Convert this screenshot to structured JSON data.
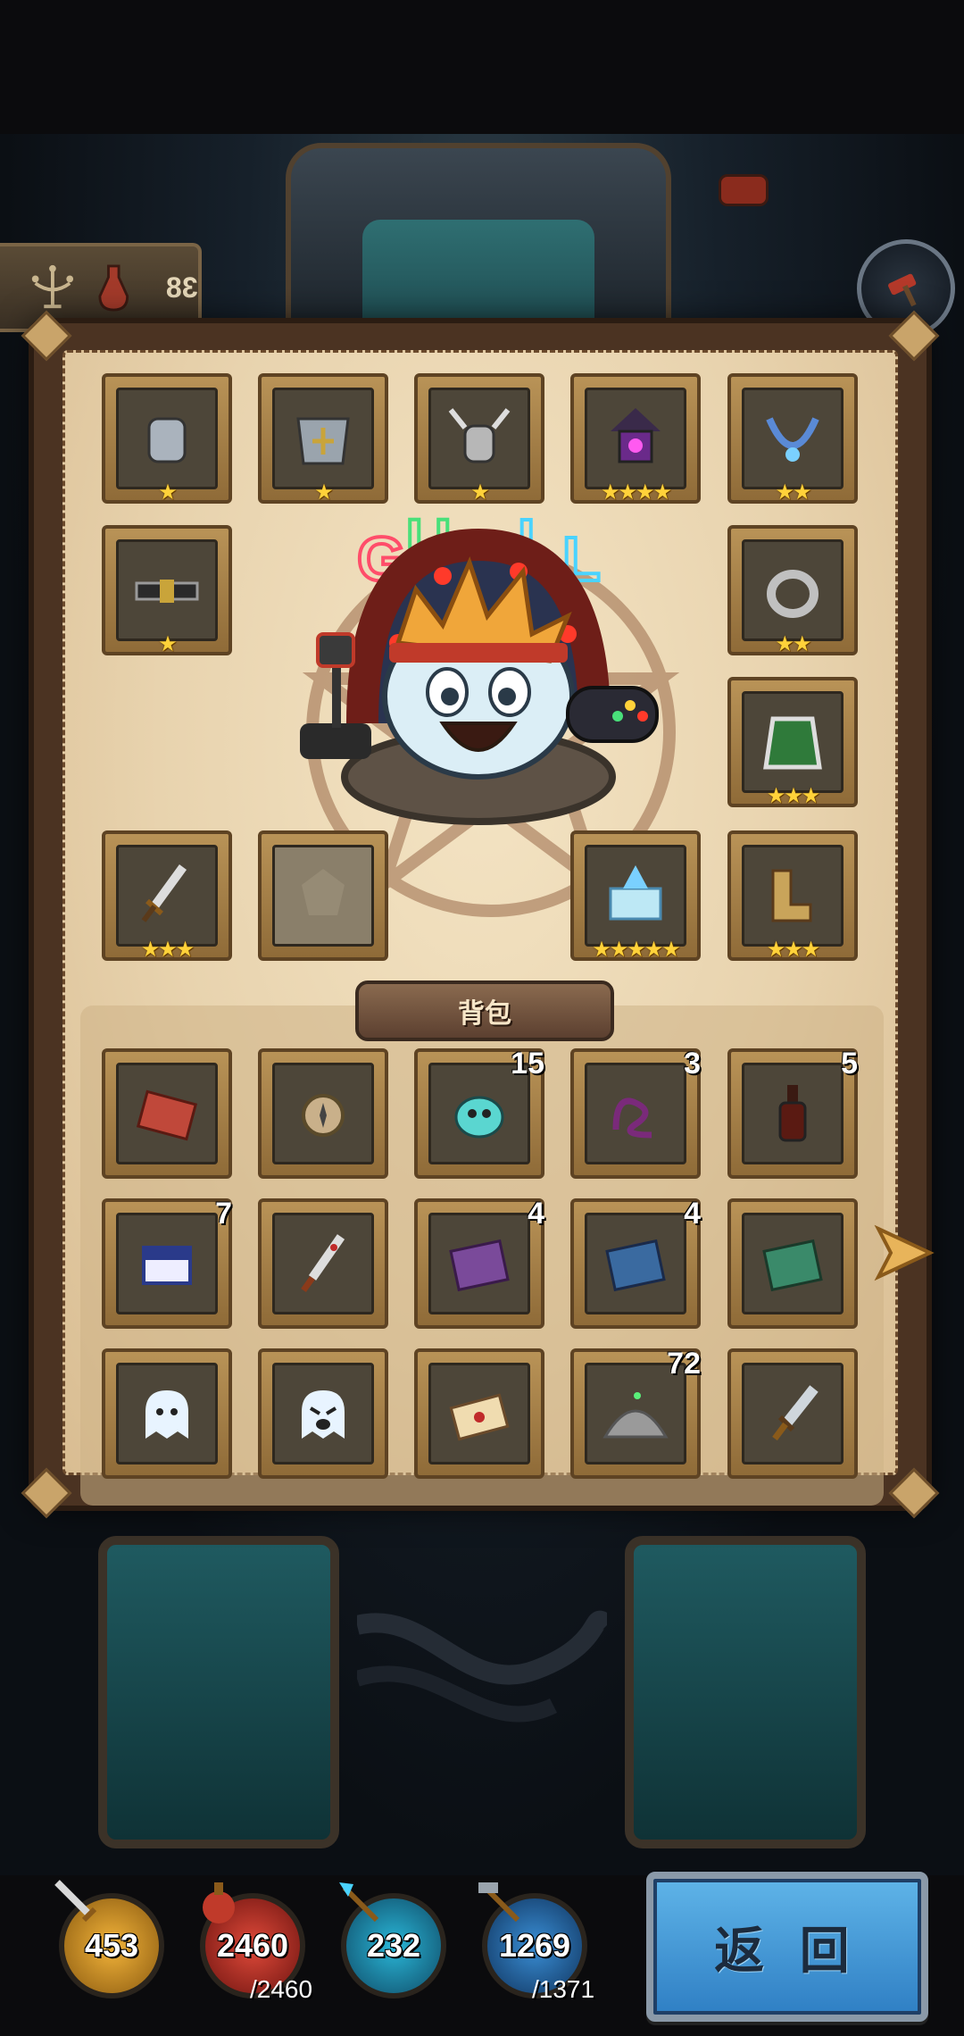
{
  "level_plate": {
    "level": "38",
    "candle_icon": "candelabra-icon",
    "potion_icon": "potion-icon"
  },
  "top_right_button": {
    "icon": "hammer-icon"
  },
  "equipment": [
    {
      "slot": "gloves",
      "icon": "gauntlet-icon",
      "stars": "★"
    },
    {
      "slot": "armor",
      "icon": "armor-icon",
      "stars": "★"
    },
    {
      "slot": "helmet",
      "icon": "winged-helmet-icon",
      "stars": "★"
    },
    {
      "slot": "lantern",
      "icon": "lantern-icon",
      "stars": "★★★★"
    },
    {
      "slot": "necklace",
      "icon": "necklace-icon",
      "stars": "★★"
    },
    {
      "slot": "belt",
      "icon": "belt-icon",
      "stars": "★"
    },
    {
      "slot": "ring",
      "icon": "ring-icon",
      "stars": "★★"
    },
    {
      "slot": "cloak",
      "icon": "cloak-icon",
      "stars": "★★★"
    },
    {
      "slot": "weapon",
      "icon": "sword-icon",
      "stars": "★★★"
    },
    {
      "slot": "empty",
      "icon": "empty-slot-icon",
      "stars": ""
    },
    {
      "slot": "book",
      "icon": "crystal-book-icon",
      "stars": "★★★★★"
    },
    {
      "slot": "boots",
      "icon": "boots-icon",
      "stars": "★★★"
    }
  ],
  "hero": {
    "name_neon": "GUMBALL",
    "icon": "gumball-hero-icon"
  },
  "bag": {
    "label": "背包",
    "items": [
      {
        "icon": "red-book-icon",
        "count": ""
      },
      {
        "icon": "compass-icon",
        "count": ""
      },
      {
        "icon": "gumball-pet-icon",
        "count": "15"
      },
      {
        "icon": "rope-icon",
        "count": "3"
      },
      {
        "icon": "wine-bottle-icon",
        "count": "5"
      },
      {
        "icon": "cigarette-pack-icon",
        "count": "7"
      },
      {
        "icon": "bloody-knife-icon",
        "count": ""
      },
      {
        "icon": "purple-book-icon",
        "count": "4"
      },
      {
        "icon": "blue-book-icon",
        "count": "4"
      },
      {
        "icon": "green-book-icon",
        "count": ""
      },
      {
        "icon": "ghost-icon",
        "count": ""
      },
      {
        "icon": "angry-ghost-icon",
        "count": ""
      },
      {
        "icon": "letter-icon",
        "count": ""
      },
      {
        "icon": "ash-pile-icon",
        "count": "72"
      },
      {
        "icon": "dagger-icon",
        "count": ""
      }
    ]
  },
  "stats": {
    "attack": "453",
    "hp": "2460",
    "hp_max": "/2460",
    "mp": "232",
    "defense": "1269",
    "defense_max": "/1371"
  },
  "return_button": "返 回",
  "colors": {
    "parchment": "#e8d3ae",
    "frame": "#4b3322",
    "slot_gold": "#b99357",
    "star": "#ffd23a",
    "button_blue": "#2f7fc4"
  }
}
